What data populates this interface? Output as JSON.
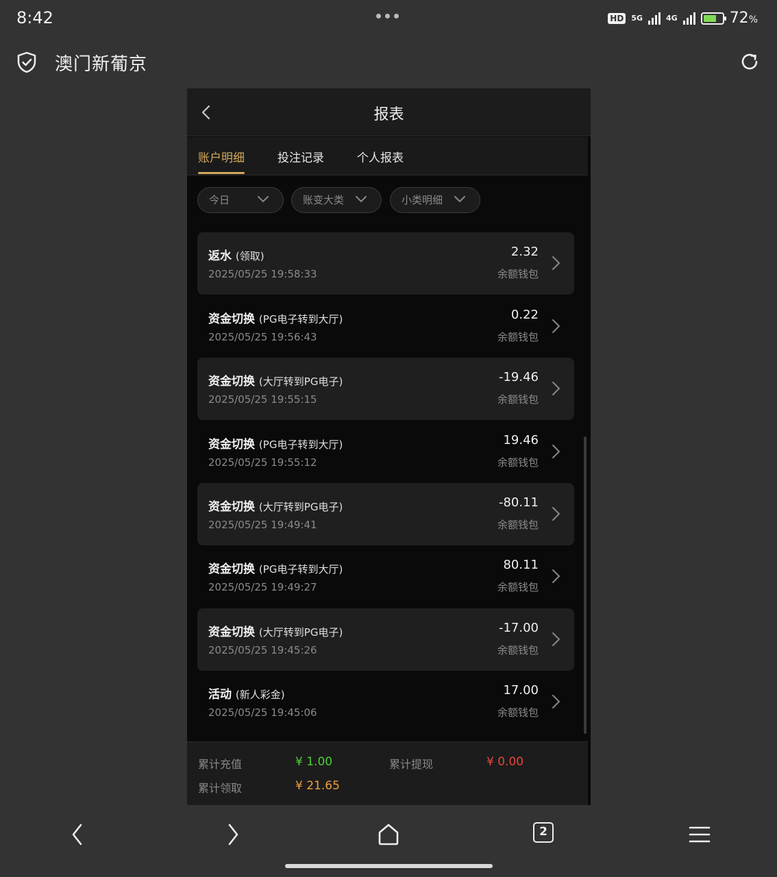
{
  "status_bar": {
    "time": "8:42",
    "hd_badge": "HD",
    "net1": "5G",
    "net2": "4G",
    "battery_level": 0.72,
    "battery_percent": "72",
    "percent_sign": "%"
  },
  "browser": {
    "site_title": "澳门新葡京",
    "shield_icon": "shield-check-icon",
    "reload_icon": "reload-icon"
  },
  "app": {
    "title": "报表",
    "tabs": [
      "账户明细",
      "投注记录",
      "个人报表"
    ],
    "active_tab": 0,
    "filters": [
      "今日",
      "账变大类",
      "小类明细"
    ]
  },
  "records": [
    {
      "title": "返水",
      "sub": "(领取)",
      "time": "2025/05/25 19:58:33",
      "amount": "2.32",
      "wallet": "余额钱包"
    },
    {
      "title": "资金切换",
      "sub": "(PG电子转到大厅)",
      "time": "2025/05/25 19:56:43",
      "amount": "0.22",
      "wallet": "余额钱包"
    },
    {
      "title": "资金切换",
      "sub": "(大厅转到PG电子)",
      "time": "2025/05/25 19:55:15",
      "amount": "-19.46",
      "wallet": "余额钱包"
    },
    {
      "title": "资金切换",
      "sub": "(PG电子转到大厅)",
      "time": "2025/05/25 19:55:12",
      "amount": "19.46",
      "wallet": "余额钱包"
    },
    {
      "title": "资金切换",
      "sub": "(大厅转到PG电子)",
      "time": "2025/05/25 19:49:41",
      "amount": "-80.11",
      "wallet": "余额钱包"
    },
    {
      "title": "资金切换",
      "sub": "(PG电子转到大厅)",
      "time": "2025/05/25 19:49:27",
      "amount": "80.11",
      "wallet": "余额钱包"
    },
    {
      "title": "资金切换",
      "sub": "(大厅转到PG电子)",
      "time": "2025/05/25 19:45:26",
      "amount": "-17.00",
      "wallet": "余额钱包"
    },
    {
      "title": "活动",
      "sub": "(新人彩金)",
      "time": "2025/05/25 19:45:06",
      "amount": "17.00",
      "wallet": "余额钱包"
    }
  ],
  "summary": {
    "recharge_label": "累计充值",
    "recharge_value": "¥ 1.00",
    "withdraw_label": "累计提现",
    "withdraw_value": "¥ 0.00",
    "claim_label": "累计领取",
    "claim_value": "¥ 21.65"
  },
  "bottom_nav": {
    "tab_count": "2"
  },
  "colors": {
    "accent_gold": "#d4a95c",
    "green": "#4cd137",
    "red": "#e8453c",
    "orange": "#f0a040"
  }
}
